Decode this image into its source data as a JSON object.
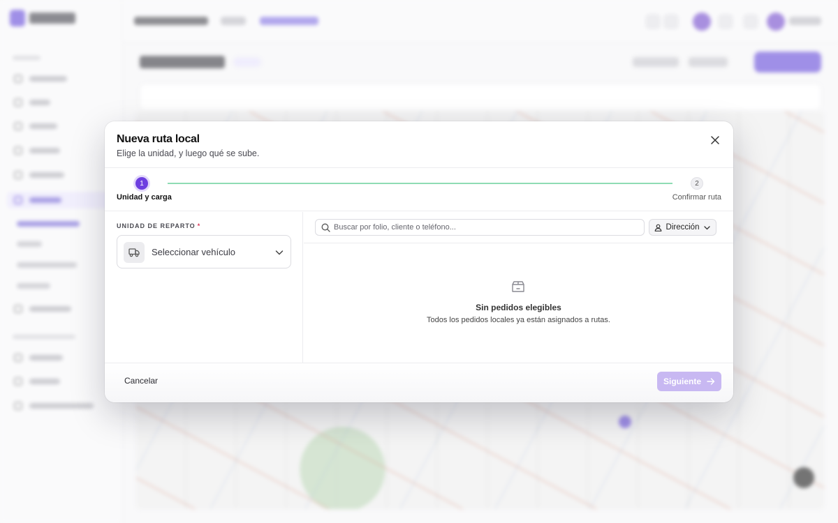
{
  "modal": {
    "title": "Nueva ruta local",
    "subtitle": "Elige la unidad, y luego qué se sube."
  },
  "stepper": {
    "steps": [
      {
        "number": "1",
        "label": "Unidad y carga",
        "state": "active"
      },
      {
        "number": "2",
        "label": "Confirmar ruta",
        "state": "pending"
      }
    ]
  },
  "vehicle": {
    "label": "UNIDAD DE REPARTO",
    "required_mark": "*",
    "placeholder": "Seleccionar vehículo"
  },
  "orders": {
    "search_placeholder": "Buscar por folio, cliente o teléfono...",
    "sort_label": "Dirección",
    "empty_title": "Sin pedidos elegibles",
    "empty_message": "Todos los pedidos locales ya están asignados a rutas."
  },
  "footer": {
    "cancel_label": "Cancelar",
    "next_label": "Siguiente",
    "next_disabled": true
  },
  "colors": {
    "accent": "#6d3fe0",
    "accent_disabled": "#c8b8f2",
    "step_line": "#8fdcb4",
    "required": "#d9385a"
  },
  "icons": [
    "close-icon",
    "truck-icon",
    "chevron-down-icon",
    "search-icon",
    "user-icon",
    "box-icon",
    "arrow-right-icon"
  ]
}
